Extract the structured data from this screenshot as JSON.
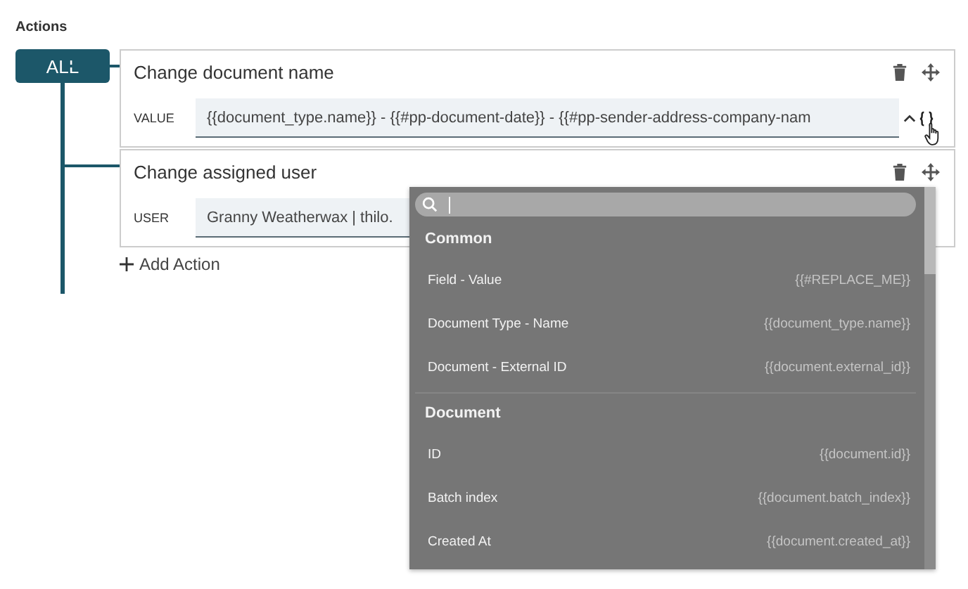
{
  "title": "Actions",
  "operator": "ALL",
  "actions": [
    {
      "title": "Change document name",
      "field_label": "VALUE",
      "value": "{{document_type.name}} - {{#pp-document-date}} - {{#pp-sender-address-company-nam",
      "placeholders_button": true
    },
    {
      "title": "Change assigned user",
      "field_label": "USER",
      "value": "Granny Weatherwax | thilo.",
      "placeholders_button": false
    }
  ],
  "add_action": "Add Action",
  "dropdown": {
    "sections": [
      {
        "title": "Common",
        "items": [
          {
            "label": "Field - Value",
            "placeholder": "{{#REPLACE_ME}}"
          },
          {
            "label": "Document Type - Name",
            "placeholder": "{{document_type.name}}"
          },
          {
            "label": "Document - External ID",
            "placeholder": "{{document.external_id}}"
          }
        ]
      },
      {
        "title": "Document",
        "items": [
          {
            "label": "ID",
            "placeholder": "{{document.id}}"
          },
          {
            "label": "Batch index",
            "placeholder": "{{document.batch_index}}"
          },
          {
            "label": "Created At",
            "placeholder": "{{document.created_at}}"
          }
        ]
      }
    ]
  }
}
